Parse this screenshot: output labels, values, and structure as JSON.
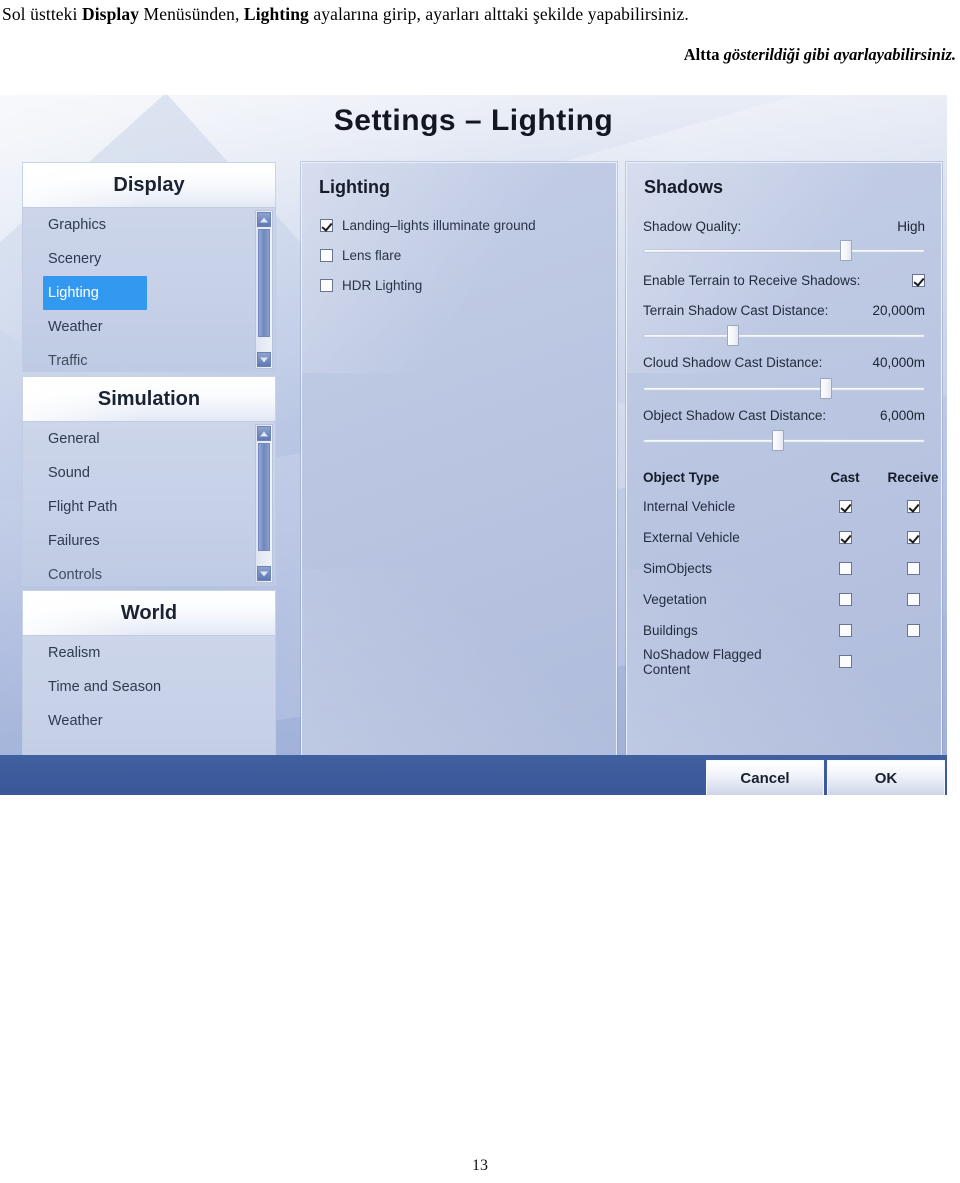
{
  "document": {
    "caption_top_parts": [
      {
        "text": "Sol üstteki ",
        "bold": false
      },
      {
        "text": "Display",
        "bold": true
      },
      {
        "text": " Menüsünden, ",
        "bold": false
      },
      {
        "text": "Lighting",
        "bold": true
      },
      {
        "text": " ayalarına girip, ayarları alttaki şekilde yapabilirsiniz.",
        "bold": false
      }
    ],
    "caption_top_plain": "Sol üstteki Display Menüsünden, Lighting ayalarına girip, ayarları alttaki şekilde yapabilirsiniz.",
    "caption_right_lead": "Altta ",
    "caption_right_italic": "gösterildiği gibi ayarlayabilirsiniz.",
    "page_number": "13"
  },
  "dialog": {
    "title": "Settings – Lighting"
  },
  "sidebar": {
    "groups": [
      {
        "header": "Display",
        "items": [
          {
            "label": "Graphics",
            "selected": false,
            "cut": false
          },
          {
            "label": "Scenery",
            "selected": false,
            "cut": false
          },
          {
            "label": "Lighting",
            "selected": true,
            "cut": false
          },
          {
            "label": "Weather",
            "selected": false,
            "cut": false
          },
          {
            "label": "Traffic",
            "selected": false,
            "cut": true
          }
        ]
      },
      {
        "header": "Simulation",
        "items": [
          {
            "label": "General",
            "selected": false,
            "cut": false
          },
          {
            "label": "Sound",
            "selected": false,
            "cut": false
          },
          {
            "label": "Flight Path",
            "selected": false,
            "cut": false
          },
          {
            "label": "Failures",
            "selected": false,
            "cut": false
          },
          {
            "label": "Controls",
            "selected": false,
            "cut": true
          }
        ]
      },
      {
        "header": "World",
        "items": [
          {
            "label": "Realism",
            "selected": false,
            "cut": false
          },
          {
            "label": "Time and Season",
            "selected": false,
            "cut": false
          },
          {
            "label": "Weather",
            "selected": false,
            "cut": false
          }
        ]
      }
    ]
  },
  "lighting_panel": {
    "title": "Lighting",
    "options": [
      {
        "label": "Landing–lights illuminate ground",
        "checked": true
      },
      {
        "label": "Lens flare",
        "checked": false
      },
      {
        "label": "HDR Lighting",
        "checked": false
      }
    ]
  },
  "shadows_panel": {
    "title": "Shadows",
    "shadow_quality": {
      "label": "Shadow Quality:",
      "value": "High",
      "slider_percent": 72
    },
    "enable_terrain": {
      "label": "Enable Terrain to Receive Shadows:",
      "checked": true
    },
    "terrain_distance": {
      "label": "Terrain Shadow Cast Distance:",
      "value": "20,000m",
      "slider_percent": 32
    },
    "cloud_distance": {
      "label": "Cloud Shadow Cast Distance:",
      "value": "40,000m",
      "slider_percent": 65
    },
    "object_distance": {
      "label": "Object Shadow Cast Distance:",
      "value": "6,000m",
      "slider_percent": 48
    },
    "table": {
      "headers": [
        "Object Type",
        "Cast",
        "Receive"
      ],
      "rows": [
        {
          "type": "Internal Vehicle",
          "cast": true,
          "receive": true,
          "has_receive": true
        },
        {
          "type": "External Vehicle",
          "cast": true,
          "receive": true,
          "has_receive": true
        },
        {
          "type": "SimObjects",
          "cast": false,
          "receive": false,
          "has_receive": true
        },
        {
          "type": "Vegetation",
          "cast": false,
          "receive": false,
          "has_receive": true
        },
        {
          "type": "Buildings",
          "cast": false,
          "receive": false,
          "has_receive": true
        },
        {
          "type": "NoShadow Flagged Content",
          "cast": false,
          "receive": false,
          "has_receive": false
        }
      ]
    }
  },
  "footer": {
    "cancel_label": "Cancel",
    "ok_label": "OK"
  },
  "colors": {
    "selection_blue": "#3399f0",
    "bottom_bar_blue": "#3d5c9d",
    "panel_bg": "#b9c5e1"
  }
}
